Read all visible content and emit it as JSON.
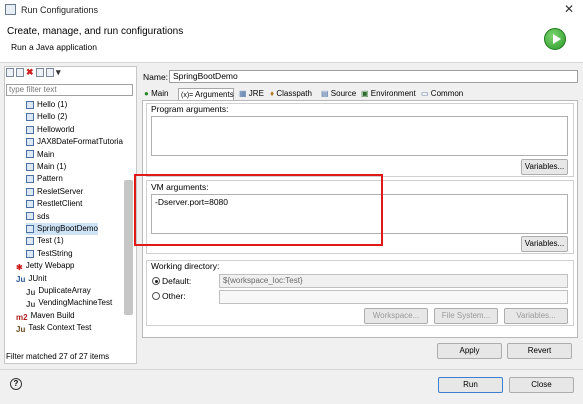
{
  "window": {
    "title": "Run Configurations",
    "close_glyph": "✕"
  },
  "header": {
    "title": "Create, manage, and run configurations",
    "subtitle": "Run a Java application"
  },
  "left": {
    "filter_placeholder": "type filter text",
    "tree": [
      {
        "label": "Hello (1)",
        "icon": "java-app-icon"
      },
      {
        "label": "Hello (2)",
        "icon": "java-app-icon"
      },
      {
        "label": "Helloworld",
        "icon": "java-app-icon"
      },
      {
        "label": "JAX8DateFormatTutoria",
        "icon": "java-app-icon"
      },
      {
        "label": "Main",
        "icon": "java-app-icon"
      },
      {
        "label": "Main (1)",
        "icon": "java-app-icon"
      },
      {
        "label": "Pattern",
        "icon": "java-app-icon"
      },
      {
        "label": "ResletServer",
        "icon": "java-app-icon"
      },
      {
        "label": "RestletClient",
        "icon": "java-app-icon"
      },
      {
        "label": "sds",
        "icon": "java-app-icon"
      },
      {
        "label": "SpringBootDemo",
        "icon": "java-app-icon",
        "selected": true
      },
      {
        "label": "Test (1)",
        "icon": "java-app-icon"
      },
      {
        "label": "TestString",
        "icon": "java-app-icon"
      },
      {
        "label": "Jetty Webapp",
        "icon": "jetty-icon"
      },
      {
        "label": "JUnit",
        "icon": "junit-icon"
      },
      {
        "label": "DuplicateArray",
        "icon": "junit-test-icon"
      },
      {
        "label": "VendingMachineTest",
        "icon": "junit-test-icon"
      },
      {
        "label": "Maven Build",
        "icon": "maven-icon"
      },
      {
        "label": "Task Context Test",
        "icon": "task-context-icon"
      }
    ],
    "status": "Filter matched 27 of 27 items"
  },
  "config": {
    "name_label": "Name:",
    "name_value": "SpringBootDemo",
    "tabs": [
      "Main",
      "Arguments",
      "JRE",
      "Classpath",
      "Source",
      "Environment",
      "Common"
    ],
    "active_tab": "Arguments",
    "program_arguments_label": "Program arguments:",
    "program_arguments_value": "",
    "variables_label": "Variables...",
    "vm_arguments_label": "VM arguments:",
    "vm_arguments_value": "-Dserver.port=8080",
    "working_directory_label": "Working directory:",
    "default_label": "Default:",
    "default_value": "${workspace_loc:Test}",
    "other_label": "Other:",
    "workspace_label": "Workspace...",
    "file_system_label": "File System...",
    "variables2_label": "Variables..."
  },
  "actions": {
    "apply": "Apply",
    "revert": "Revert"
  },
  "footer": {
    "help": "?",
    "run": "Run",
    "close": "Close"
  },
  "colors": {
    "highlight": "#e01818",
    "selection": "#cfe3f7"
  }
}
